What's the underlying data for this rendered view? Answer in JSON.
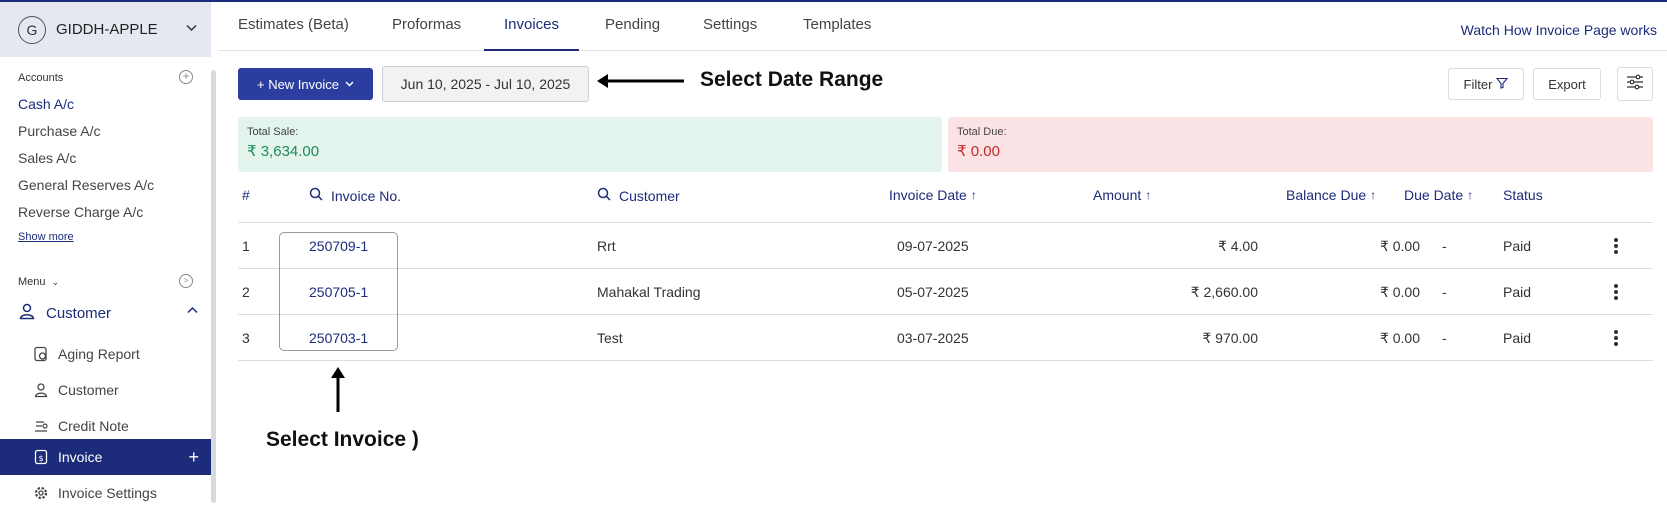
{
  "company": {
    "avatar_letter": "G",
    "name": "GIDDH-APPLE"
  },
  "accounts": {
    "heading": "Accounts",
    "items": [
      "Cash A/c",
      "Purchase A/c",
      "Sales A/c",
      "General Reserves A/c",
      "Reverse Charge A/c"
    ],
    "show_more": "Show more"
  },
  "menu": {
    "heading": "Menu",
    "group": "Customer",
    "sub_items": [
      {
        "label": "Aging Report",
        "icon": "aging-report-icon"
      },
      {
        "label": "Customer",
        "icon": "customer-icon"
      },
      {
        "label": "Credit Note",
        "icon": "credit-note-icon"
      },
      {
        "label": "Invoice",
        "icon": "invoice-icon",
        "active": true
      },
      {
        "label": "Invoice Settings",
        "icon": "gear-icon"
      }
    ]
  },
  "tabs": [
    "Estimates (Beta)",
    "Proformas",
    "Invoices",
    "Pending",
    "Settings",
    "Templates"
  ],
  "active_tab": "Invoices",
  "watch_link": "Watch How Invoice Page works",
  "toolbar": {
    "new_invoice": "+ New Invoice",
    "date_range": "Jun 10, 2025 - Jul 10, 2025",
    "filter": "Filter",
    "export": "Export"
  },
  "annotations": {
    "date": "Select Date Range",
    "invoice": "Select Invoice )"
  },
  "summary": {
    "sale_label": "Total Sale:",
    "sale_value": "₹ 3,634.00",
    "due_label": "Total Due:",
    "due_value": "₹ 0.00"
  },
  "table": {
    "headers": {
      "num": "#",
      "invoice_no": "Invoice No.",
      "customer": "Customer",
      "invoice_date": "Invoice Date",
      "amount": "Amount",
      "balance_due": "Balance Due",
      "due_date": "Due Date",
      "status": "Status"
    },
    "rows": [
      {
        "num": "1",
        "invoice_no": "250709-1",
        "customer": "Rrt",
        "date": "09-07-2025",
        "amount": "₹ 4.00",
        "balance": "₹ 0.00",
        "due": "-",
        "status": "Paid"
      },
      {
        "num": "2",
        "invoice_no": "250705-1",
        "customer": "Mahakal Trading",
        "date": "05-07-2025",
        "amount": "₹ 2,660.00",
        "balance": "₹ 0.00",
        "due": "-",
        "status": "Paid"
      },
      {
        "num": "3",
        "invoice_no": "250703-1",
        "customer": "Test",
        "date": "03-07-2025",
        "amount": "₹ 970.00",
        "balance": "₹ 0.00",
        "due": "-",
        "status": "Paid"
      }
    ]
  },
  "colors": {
    "primary": "#1c2b7a",
    "button": "#2b3ea0",
    "sale_bg": "#e3f4ec",
    "due_bg": "#fbe3e5"
  }
}
